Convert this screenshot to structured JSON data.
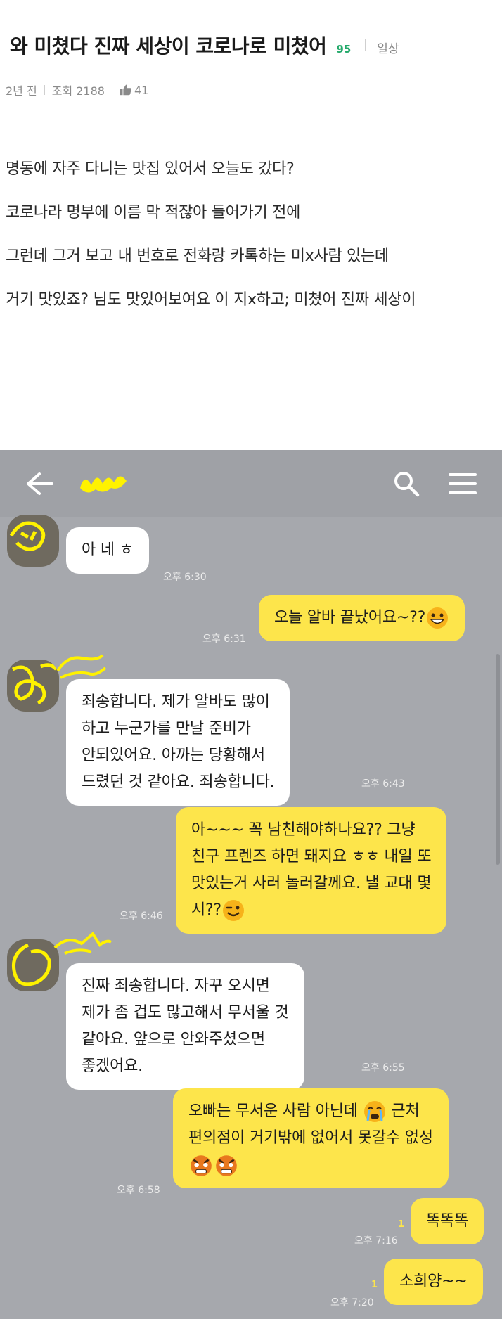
{
  "post": {
    "title": "와 미쳤다 진짜 세상이 코로나로 미쳤어",
    "comment_count": "95",
    "category": "일상",
    "time_ago": "2년 전",
    "views": "조회 2188",
    "likes": "41",
    "body_lines": [
      "명동에 자주 다니는 맛집 있어서 오늘도 갔다?",
      "코로나라 명부에 이름 막 적잖아 들어가기 전에",
      "그런데 그거 보고 내 번호로 전화랑 카톡하는 미x사람 있는데",
      "거기 맛있죠? 님도 맛있어보여요 이 지x하고; 미쳤어 진짜 세상이"
    ]
  },
  "chat": {
    "icons": {
      "back": "back-arrow-icon",
      "search": "search-icon",
      "menu": "hamburger-menu-icon"
    },
    "colors": {
      "background": "#a6a8ad",
      "incoming": "#ffffff",
      "outgoing": "#fde54b",
      "scribble": "#fff200"
    },
    "messages": [
      {
        "dir": "in",
        "lines": [
          "아 네 ㅎ"
        ],
        "time": "오후 6:30"
      },
      {
        "dir": "out",
        "lines": [
          "오늘 알바 끝났어요~??"
        ],
        "emoji": "grinning-face",
        "time": "오후 6:31"
      },
      {
        "dir": "in",
        "lines": [
          "죄송합니다. 제가 알바도 많이",
          "하고 누군가를 만날 준비가",
          "안되있어요. 아까는 당황해서",
          "드렸던 것 같아요. 죄송합니다."
        ],
        "time": "오후 6:43"
      },
      {
        "dir": "out",
        "lines": [
          "아~~~ 꼭 남친해야하나요?? 그냥",
          "친구 프렌즈 하면 돼지요 ㅎㅎ 내일 또",
          "맛있는거 사러 놀러갈께요. 낼 교대 몇",
          "시??"
        ],
        "emoji": "winking-face",
        "time": "오후 6:46"
      },
      {
        "dir": "in",
        "lines": [
          "진짜 죄송합니다. 자꾸 오시면",
          "제가 좀 겁도 많고해서 무서울 것",
          "같아요. 앞으로 안와주셨으면",
          "좋겠어요."
        ],
        "time": "오후 6:55"
      },
      {
        "dir": "out",
        "lines": [
          "오빠는 무서운 사람 아닌데",
          "편의점이 거기밖에 없어서 못갈수 없성"
        ],
        "emoji": "crying-face, angry-faces",
        "time": "오후 6:58"
      },
      {
        "dir": "out",
        "lines": [
          "똑똑똑"
        ],
        "time": "오후 7:16",
        "unread": "1"
      },
      {
        "dir": "out",
        "lines": [
          "소희양~~"
        ],
        "time": "오후 7:20",
        "unread": "1"
      }
    ],
    "first_line_tail": "근처"
  }
}
